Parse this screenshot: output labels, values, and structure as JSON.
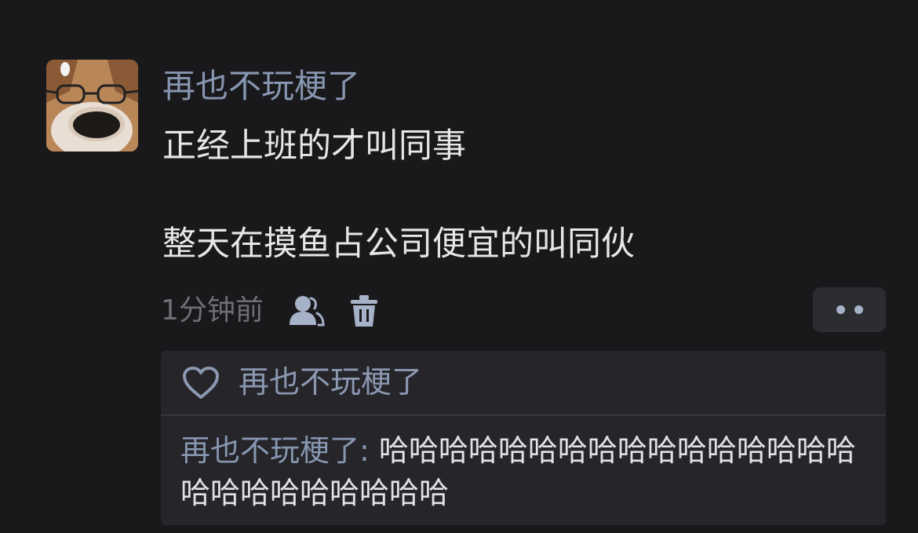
{
  "comment": {
    "username": "再也不玩梗了",
    "line_1": "正经上班的才叫同事",
    "line_2": "整天在摸鱼占公司便宜的叫同伙",
    "timestamp": "1分钟前"
  },
  "actions": {
    "user_icon": "user-icon",
    "delete_icon": "trash-icon",
    "more_icon": "more-dots-icon"
  },
  "reply_panel": {
    "like_icon": "heart-icon",
    "liked_by": "再也不玩梗了",
    "reply_author": "再也不玩梗了",
    "reply_separator": ": ",
    "reply_body": "哈哈哈哈哈哈哈哈哈哈哈哈哈哈哈哈哈哈哈哈哈哈哈哈哈"
  },
  "colors": {
    "background": "#19191b",
    "username": "#8796b0",
    "text": "#e6e6e8",
    "muted": "#6e6e73",
    "panel": "#25252a",
    "icon": "#a6b2c8"
  }
}
